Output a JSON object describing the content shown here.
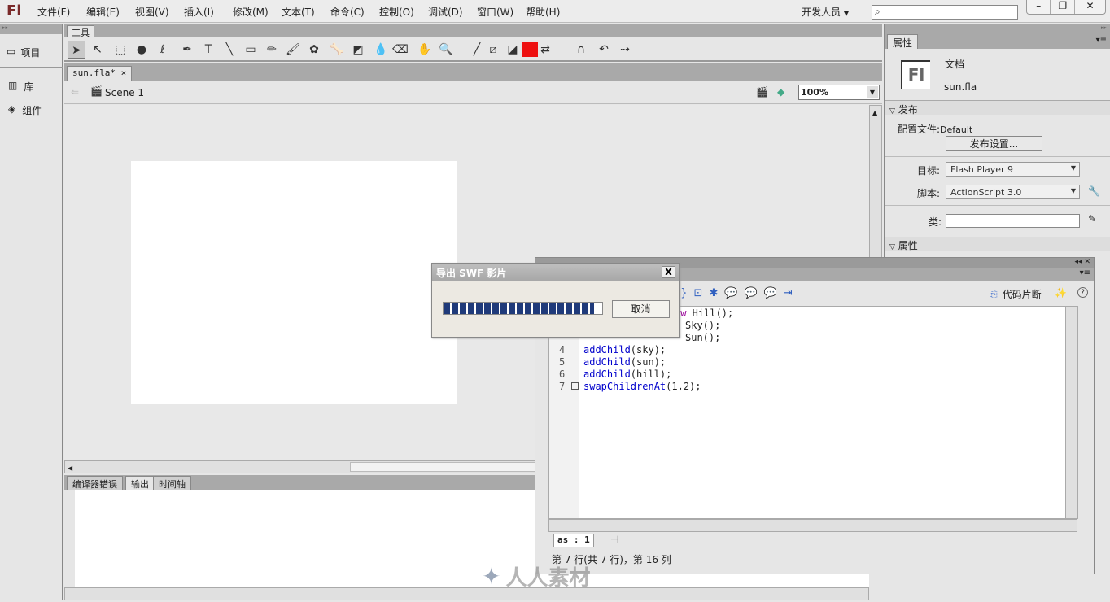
{
  "app": {
    "logo": "Fl",
    "workspace": "开发人员",
    "search_placeholder": ""
  },
  "menu": [
    "文件(F)",
    "编辑(E)",
    "视图(V)",
    "插入(I)",
    "修改(M)",
    "文本(T)",
    "命令(C)",
    "控制(O)",
    "调试(D)",
    "窗口(W)",
    "帮助(H)"
  ],
  "left_panel": {
    "items": [
      {
        "label": "项目",
        "icon": "project-icon"
      },
      {
        "label": "库",
        "icon": "library-icon"
      },
      {
        "label": "组件",
        "icon": "components-icon"
      }
    ]
  },
  "tools": {
    "tab": "工具",
    "fill_color": "#ee1111"
  },
  "document": {
    "tab": "sun.fla*",
    "close": "×",
    "scene": "Scene 1",
    "zoom": "100%"
  },
  "bottom_panel": {
    "tabs": [
      "编译器错误",
      "输出",
      "时间轴"
    ],
    "active": 1
  },
  "properties": {
    "tab": "属性",
    "doc_label": "文档",
    "doc_name": "sun.fla",
    "publish_section": "发布",
    "profile_label": "配置文件:",
    "profile_value": "Default",
    "publish_settings": "发布设置...",
    "target_label": "目标:",
    "target_value": "Flash Player 9",
    "script_label": "脚本:",
    "script_value": "ActionScript 3.0",
    "class_label": "类:",
    "class_value": "",
    "props_section": "属性"
  },
  "actions": {
    "snippets": "代码片断",
    "line_numbers": [
      "4",
      "5",
      "6",
      "7"
    ],
    "partial_lines": [
      {
        "kw": "ew",
        "rest": " Hill();"
      },
      {
        "kw": "",
        "rest": "Sky();"
      },
      {
        "kw": "",
        "rest": "Sun();"
      }
    ],
    "lines": [
      "addChild(sky);",
      "addChild(sun);",
      "addChild(hill);",
      "swapChildrenAt(1,2);"
    ],
    "file_tab": "as : 1",
    "status": "第 7 行(共 7 行)，第 16 列"
  },
  "dialog": {
    "title": "导出 SWF 影片",
    "close": "X",
    "cancel": "取消",
    "progress": 0.95,
    "progress_color": "#1f3a7a"
  },
  "watermark": "人人素材"
}
